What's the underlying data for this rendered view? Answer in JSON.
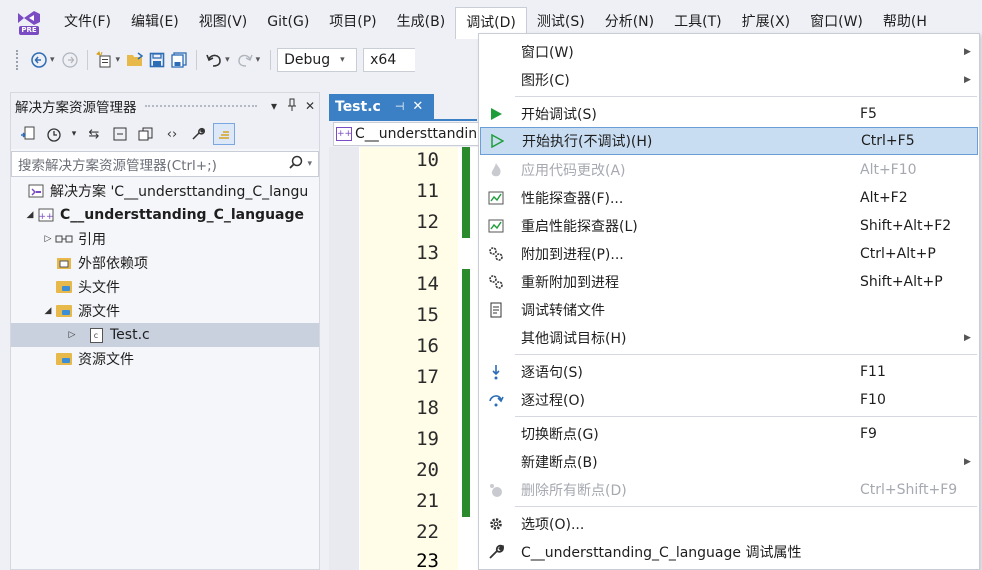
{
  "menubar": {
    "items": [
      "文件(F)",
      "编辑(E)",
      "视图(V)",
      "Git(G)",
      "项目(P)",
      "生成(B)",
      "调试(D)",
      "测试(S)",
      "分析(N)",
      "工具(T)",
      "扩展(X)",
      "窗口(W)",
      "帮助(H"
    ],
    "active_index": 6,
    "logo_badge": "PRE"
  },
  "toolbar": {
    "config": "Debug",
    "platform": "x64"
  },
  "solution_explorer": {
    "title": "解决方案资源管理器",
    "pin_icon": "pin-icon",
    "close_icon": "close-icon",
    "search_placeholder": "搜索解决方案资源管理器(Ctrl+;)",
    "tree": [
      {
        "label": "解决方案 'C__understtanding_C_langu",
        "level": 0,
        "twisty": "",
        "icon": "solution-icon"
      },
      {
        "label": "C__understtanding_C_language",
        "level": 0,
        "twisty": "◢",
        "icon": "project-icon",
        "bold": true
      },
      {
        "label": "引用",
        "level": 1,
        "twisty": "▷",
        "icon": "references-icon"
      },
      {
        "label": "外部依赖项",
        "level": 1,
        "twisty": "",
        "icon": "external-deps-icon"
      },
      {
        "label": "头文件",
        "level": 1,
        "twisty": "",
        "icon": "folder-icon"
      },
      {
        "label": "源文件",
        "level": 1,
        "twisty": "◢",
        "icon": "folder-icon"
      },
      {
        "label": "Test.c",
        "level": 2,
        "twisty": "▷",
        "icon": "c-file-icon",
        "selected": true
      },
      {
        "label": "资源文件",
        "level": 1,
        "twisty": "",
        "icon": "folder-icon"
      }
    ]
  },
  "editor": {
    "tab_label": "Test.c",
    "nav_label": "C__understtandin",
    "line_numbers": [
      "10",
      "11",
      "12",
      "13",
      "14",
      "15",
      "16",
      "17",
      "18",
      "19",
      "20",
      "21",
      "22",
      "23"
    ]
  },
  "debug_menu": {
    "items": [
      {
        "label": "窗口(W)",
        "shortcut": "",
        "submenu": true,
        "icon": ""
      },
      {
        "label": "图形(C)",
        "shortcut": "",
        "submenu": true,
        "icon": ""
      },
      {
        "label": "开始调试(S)",
        "shortcut": "F5",
        "icon": "play-icon"
      },
      {
        "label": "开始执行(不调试)(H)",
        "shortcut": "Ctrl+F5",
        "icon": "play-outline-icon",
        "highlighted": true
      },
      {
        "label": "应用代码更改(A)",
        "shortcut": "Alt+F10",
        "icon": "flame-icon",
        "disabled": true
      },
      {
        "label": "性能探查器(F)...",
        "shortcut": "Alt+F2",
        "icon": "profiler-icon"
      },
      {
        "label": "重启性能探查器(L)",
        "shortcut": "Shift+Alt+F2",
        "icon": "profiler-icon"
      },
      {
        "label": "附加到进程(P)...",
        "shortcut": "Ctrl+Alt+P",
        "icon": "gears-icon"
      },
      {
        "label": "重新附加到进程",
        "shortcut": "Shift+Alt+P",
        "icon": "gears-icon"
      },
      {
        "label": "调试转储文件",
        "shortcut": "",
        "icon": "dump-file-icon"
      },
      {
        "label": "其他调试目标(H)",
        "shortcut": "",
        "submenu": true,
        "icon": ""
      },
      {
        "label": "逐语句(S)",
        "shortcut": "F11",
        "icon": "step-into-icon"
      },
      {
        "label": "逐过程(O)",
        "shortcut": "F10",
        "icon": "step-over-icon"
      },
      {
        "label": "切换断点(G)",
        "shortcut": "F9",
        "icon": ""
      },
      {
        "label": "新建断点(B)",
        "shortcut": "",
        "submenu": true,
        "icon": ""
      },
      {
        "label": "删除所有断点(D)",
        "shortcut": "Ctrl+Shift+F9",
        "icon": "delete-breakpoints-icon",
        "disabled": true
      },
      {
        "label": "选项(O)...",
        "shortcut": "",
        "icon": "gear-icon"
      },
      {
        "label": "C__understtanding_C_language 调试属性",
        "shortcut": "",
        "icon": "wrench-icon"
      }
    ]
  },
  "colors": {
    "accent": "#3b7fc4",
    "highlight": "#c9ddf2",
    "change_bar": "#2b8a2b",
    "play_green": "#1e9e3a"
  }
}
